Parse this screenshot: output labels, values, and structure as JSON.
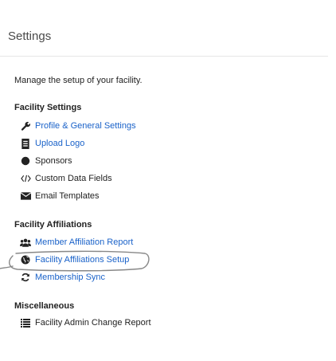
{
  "header": {
    "title": "Settings"
  },
  "intro": "Manage the setup of your facility.",
  "sections": [
    {
      "title": "Facility Settings",
      "items": [
        {
          "label": "Profile & General Settings",
          "icon": "wrench-icon",
          "link": true
        },
        {
          "label": "Upload Logo",
          "icon": "document-icon",
          "link": true
        },
        {
          "label": "Sponsors",
          "icon": "certificate-icon",
          "link": false
        },
        {
          "label": "Custom Data Fields",
          "icon": "code-icon",
          "link": false
        },
        {
          "label": "Email Templates",
          "icon": "envelope-icon",
          "link": false
        }
      ]
    },
    {
      "title": "Facility Affiliations",
      "items": [
        {
          "label": "Member Affiliation Report",
          "icon": "users-icon",
          "link": true
        },
        {
          "label": "Facility Affiliations Setup",
          "icon": "globe-icon",
          "link": true
        },
        {
          "label": "Membership Sync",
          "icon": "refresh-icon",
          "link": true
        }
      ]
    },
    {
      "title": "Miscellaneous",
      "items": [
        {
          "label": "Facility Admin Change Report",
          "icon": "list-icon",
          "link": false
        }
      ]
    }
  ],
  "colors": {
    "link": "#1a62c9",
    "text": "#222222",
    "header": "#4a4a4a",
    "annotation": "#888888"
  }
}
